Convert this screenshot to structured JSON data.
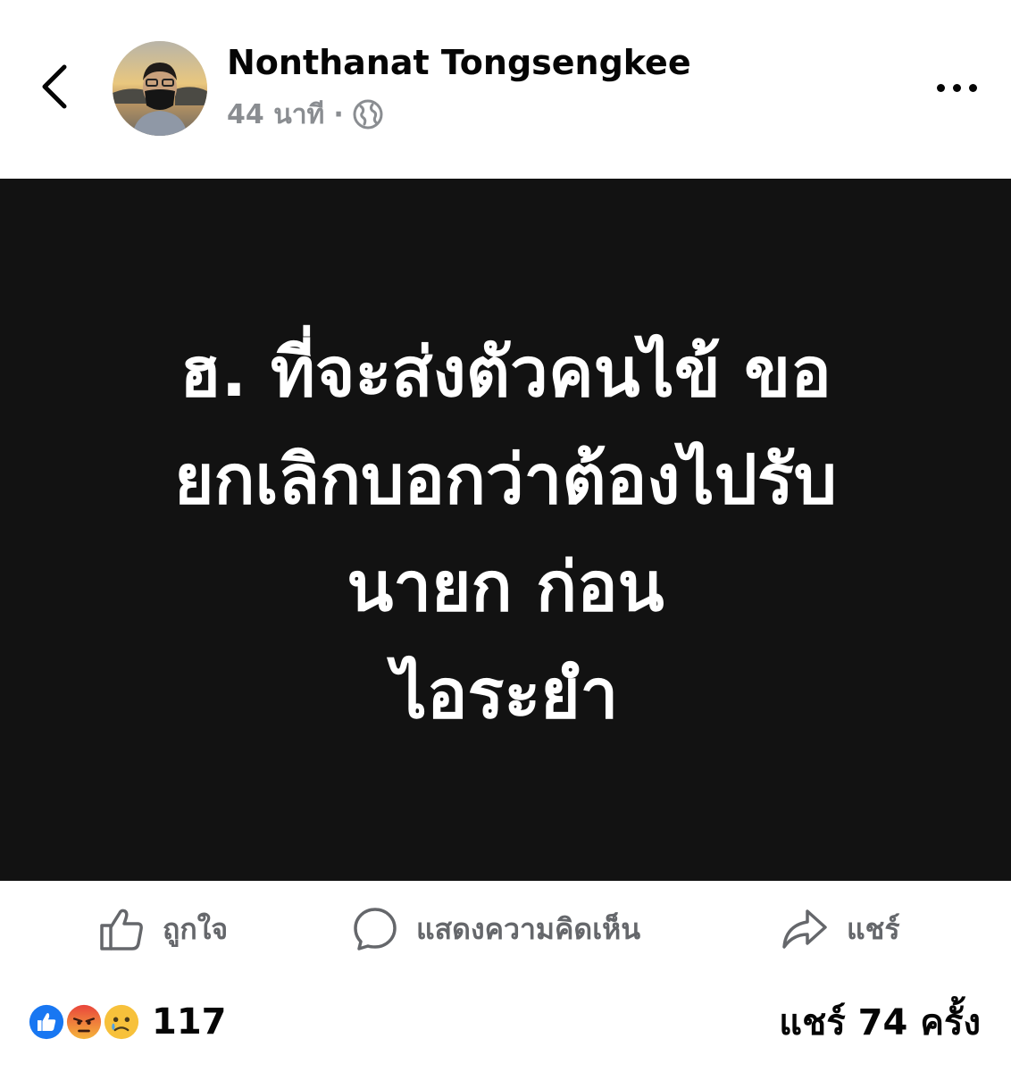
{
  "header": {
    "author_name": "Nonthanat Tongsengkee",
    "time_ago": "44 นาที",
    "separator": "·",
    "privacy_icon": "globe-icon",
    "back_icon": "chevron-left-icon",
    "more_icon": "more-horizontal-icon"
  },
  "post": {
    "background_color": "#121212",
    "text_color": "#ffffff",
    "lines": [
      "ฮ. ที่จะส่งตัวคนไข้ ขอ",
      "ยกเลิกบอกว่าต้องไปรับ",
      "นายก ก่อน",
      "ไอระยำ"
    ]
  },
  "actions": {
    "like_label": "ถูกใจ",
    "comment_label": "แสดงความคิดเห็น",
    "share_label": "แชร์"
  },
  "footer": {
    "reaction_icons": [
      "like-reaction-icon",
      "angry-reaction-icon",
      "sad-reaction-icon"
    ],
    "reaction_count": "117",
    "shares_text": "แชร์ 74 ครั้ง"
  },
  "colors": {
    "secondary_text": "#8a8d91",
    "action_text": "#65676b",
    "like_blue": "#1877f2",
    "angry_red": "#e9453c",
    "sad_yellow": "#f7c13b"
  }
}
